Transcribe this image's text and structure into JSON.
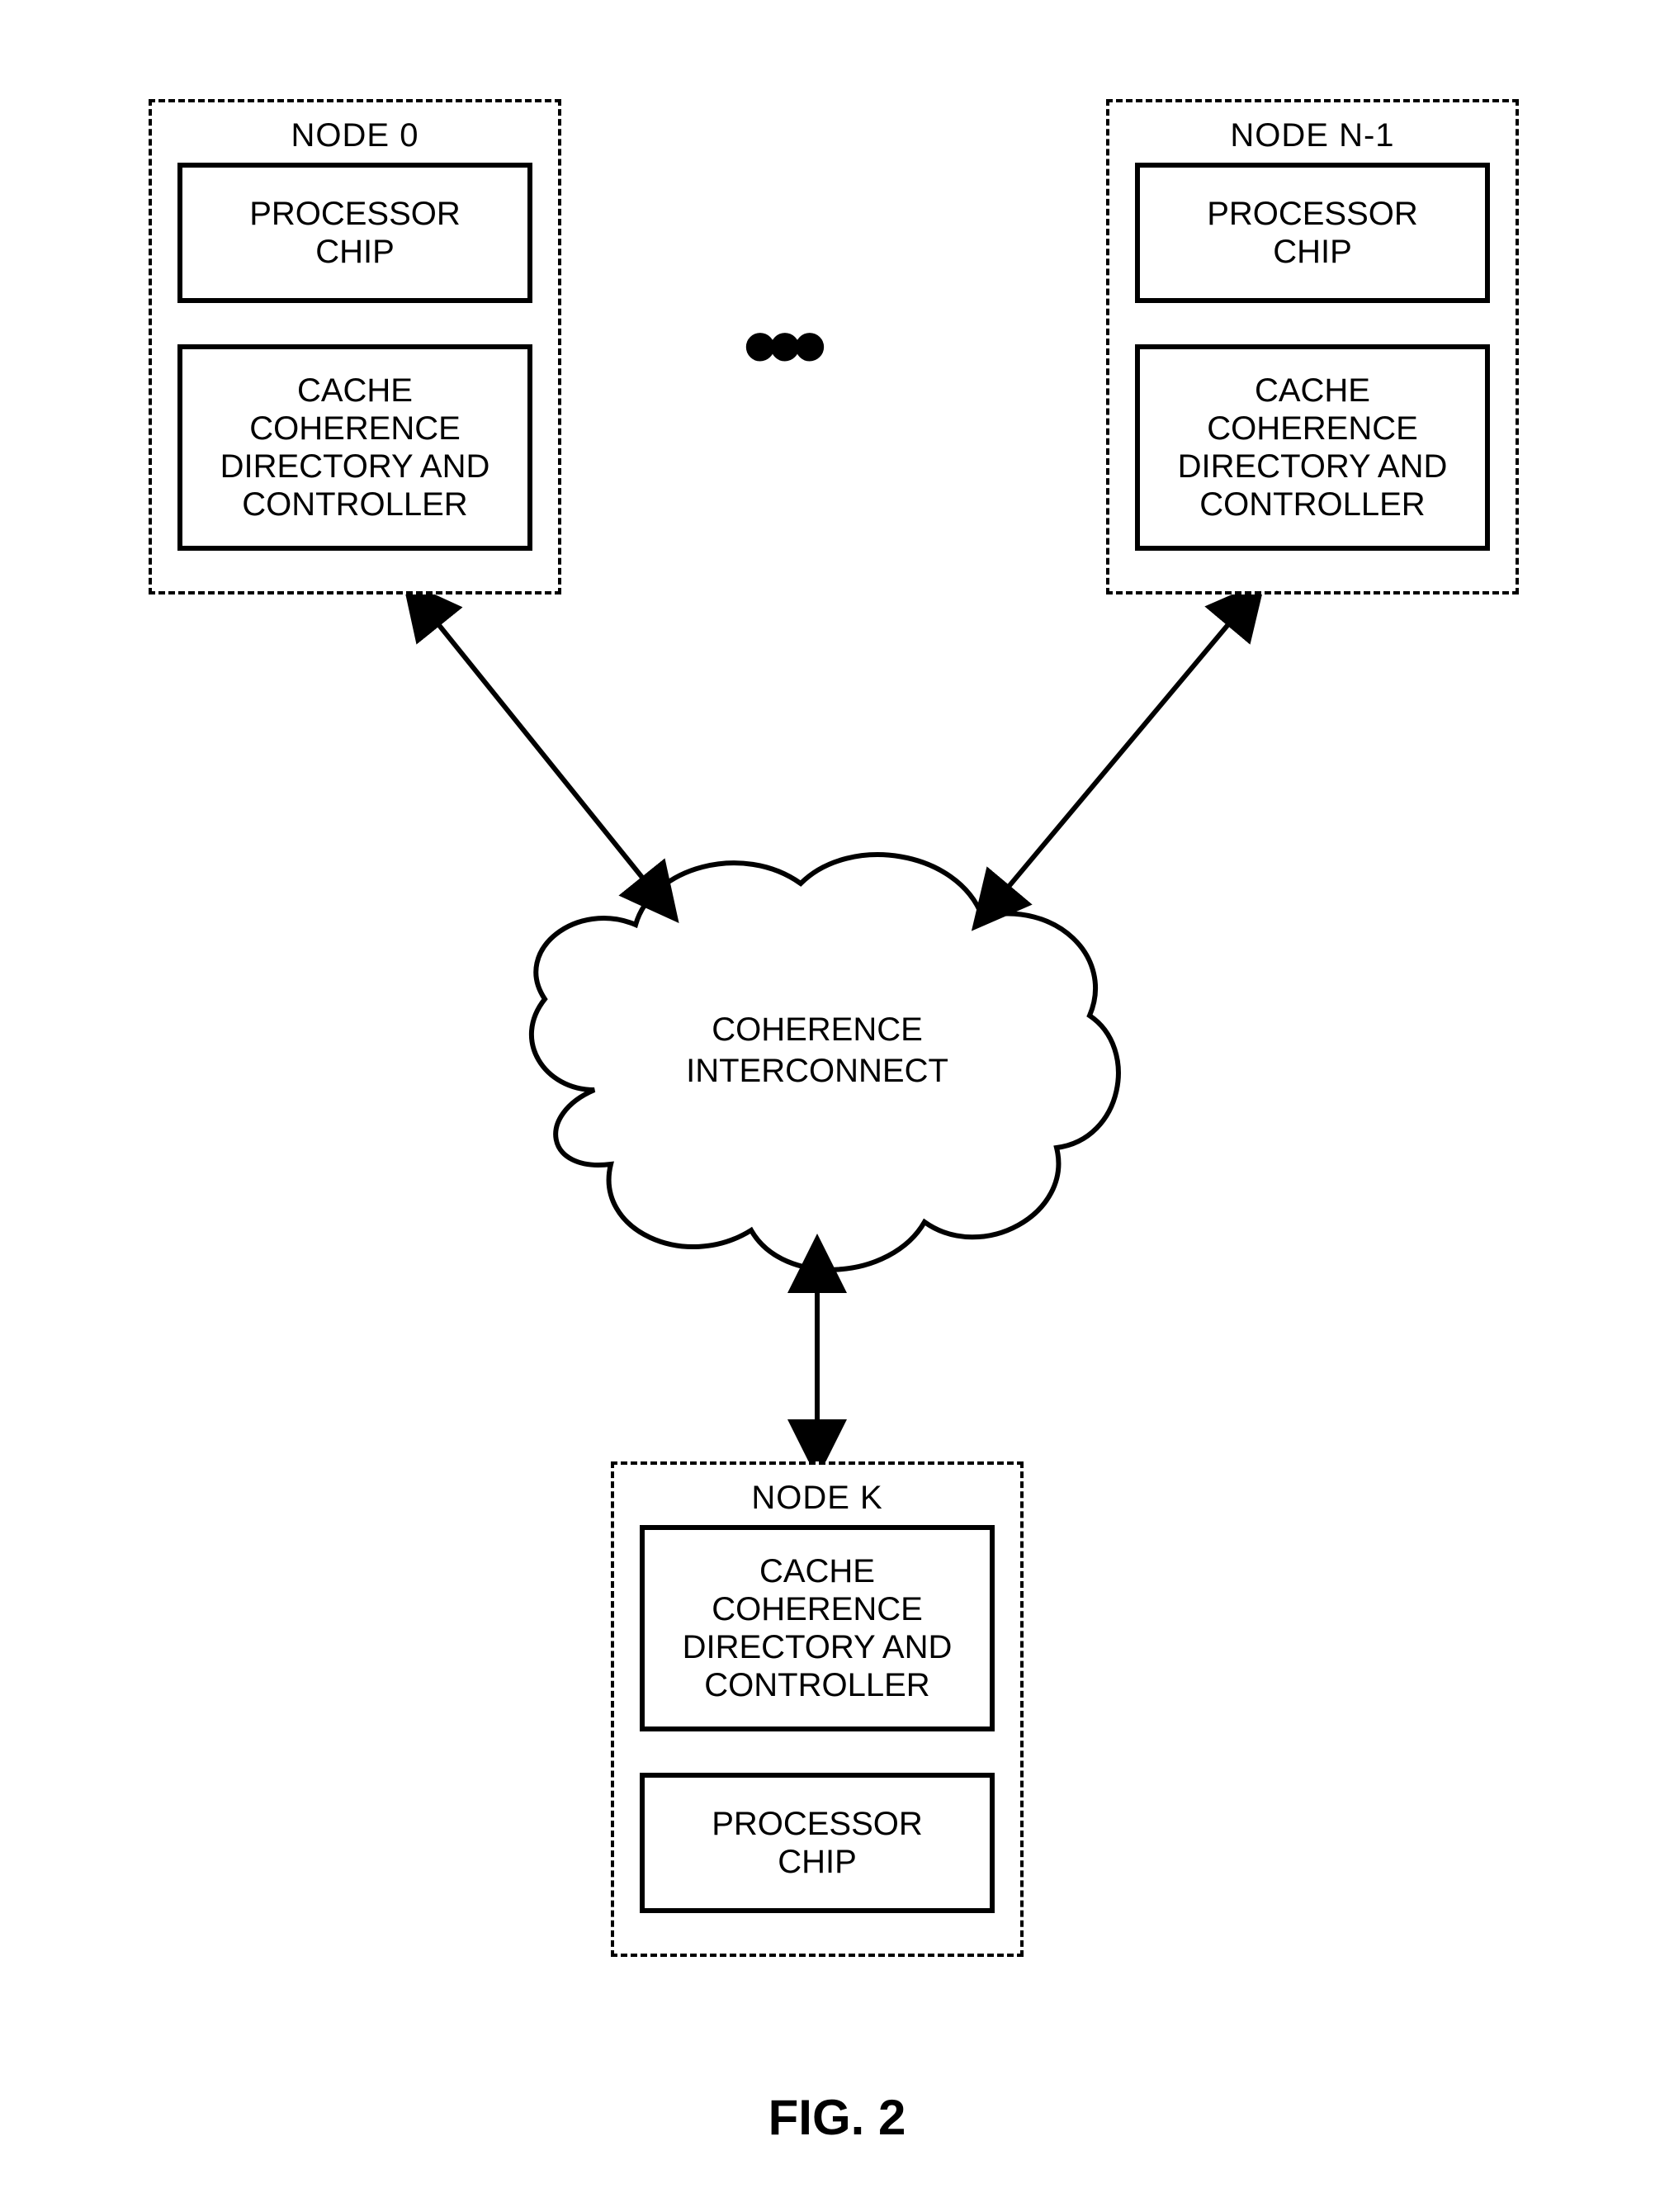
{
  "figure_label": "FIG. 2",
  "ellipsis": "•••",
  "interconnect": {
    "label_line1": "COHERENCE",
    "label_line2": "INTERCONNECT"
  },
  "nodes": {
    "top_left": {
      "title": "NODE 0",
      "block_top": "PROCESSOR\nCHIP",
      "block_bottom": "CACHE\nCOHERENCE\nDIRECTORY AND\nCONTROLLER"
    },
    "top_right": {
      "title": "NODE N-1",
      "block_top": "PROCESSOR\nCHIP",
      "block_bottom": "CACHE\nCOHERENCE\nDIRECTORY AND\nCONTROLLER"
    },
    "bottom": {
      "title": "NODE K",
      "block_top": "CACHE\nCOHERENCE\nDIRECTORY AND\nCONTROLLER",
      "block_bottom": "PROCESSOR\nCHIP"
    }
  }
}
